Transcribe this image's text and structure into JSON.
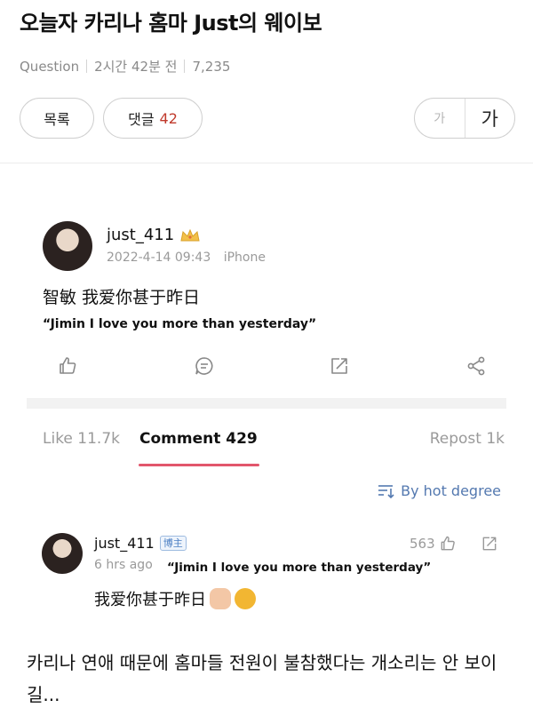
{
  "header": {
    "title": "오늘자 카리나 홈마 Just의 웨이보",
    "category": "Question",
    "time_ago": "2시간 42분 전",
    "views": "7,235"
  },
  "buttons": {
    "list_label": "목록",
    "comments_label": "댓글",
    "comments_count": "42",
    "font_small": "가",
    "font_large": "가"
  },
  "post": {
    "username": "just_411",
    "date": "2022-4-14 09:43",
    "device": "iPhone",
    "text_cn": "智敏 我爱你甚于昨日",
    "text_en": "“Jimin I love you more than yesterday”"
  },
  "tabs": {
    "like": "Like 11.7k",
    "comment": "Comment 429",
    "repost": "Repost 1k"
  },
  "sort_label": "By hot degree",
  "comment": {
    "username": "just_411",
    "badge": "博主",
    "time": "6 hrs ago",
    "quote": "“Jimin I love you more than yesterday”",
    "likes": "563",
    "text": "我爱你甚于昨日"
  },
  "body_text": "카리나 연애 때문에 홈마들 전원이 불참했다는 개소리는 안 보이길...",
  "colors": {
    "accent_red": "#c0392b",
    "tab_underline": "#e2566c",
    "link_blue": "#5479b0"
  }
}
